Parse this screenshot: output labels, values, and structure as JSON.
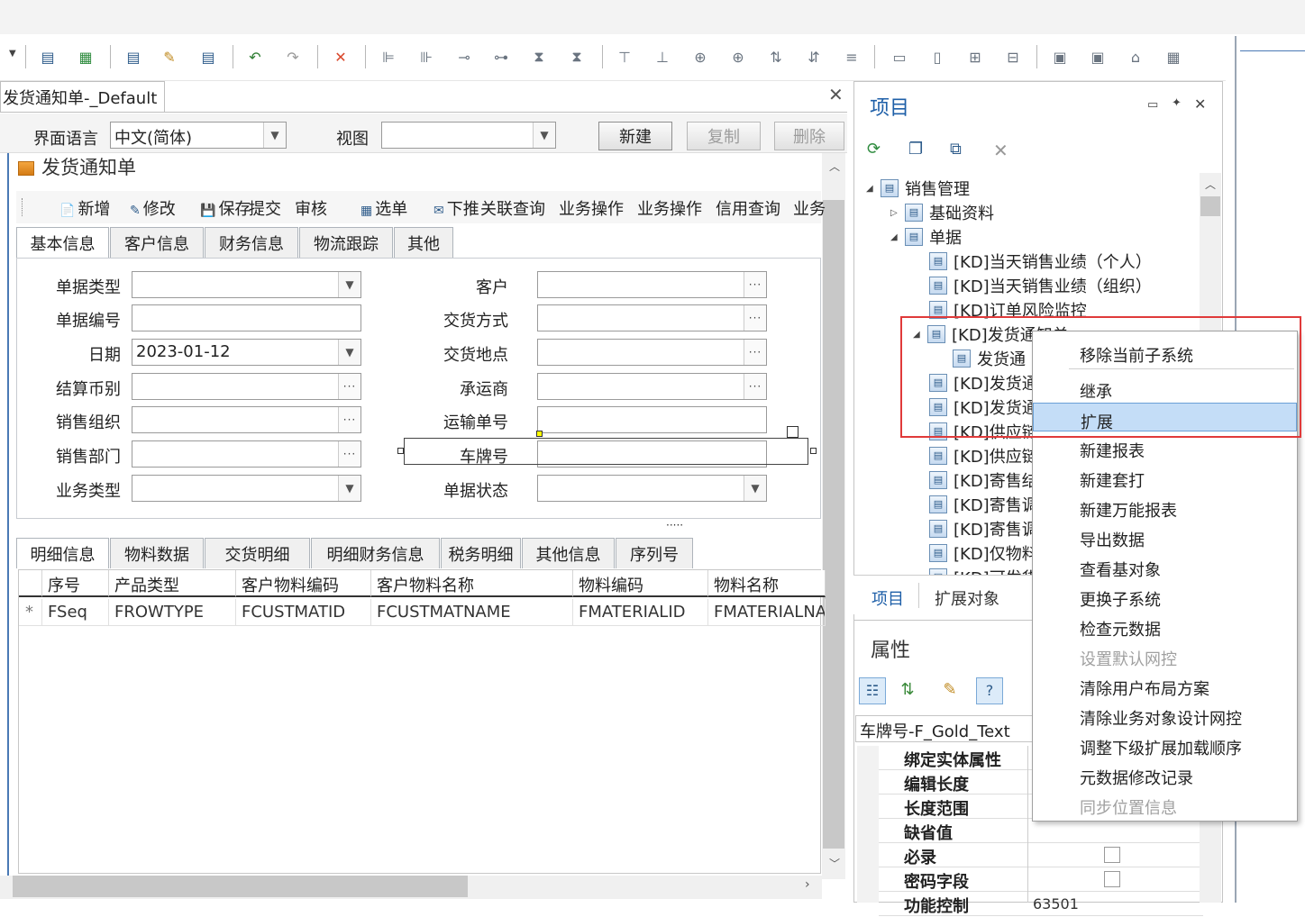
{
  "designer": {
    "doc_tab": "发货通知单-_Default",
    "lang_label": "界面语言",
    "lang_value": "中文(简体)",
    "view_label": "视图",
    "view_value": "",
    "btn_new": "新建",
    "btn_copy": "复制",
    "btn_delete": "删除",
    "form_title": "发货通知单"
  },
  "form_toolbar": {
    "items": [
      "新增",
      "修改",
      "保存",
      "提交",
      "审核",
      "选单",
      "下推",
      "关联查询",
      "业务操作",
      "业务操作",
      "信用查询",
      "业务"
    ]
  },
  "head_tabs": [
    "基本信息",
    "客户信息",
    "财务信息",
    "物流跟踪",
    "其他"
  ],
  "left_fields": [
    {
      "label": "单据类型",
      "value": "",
      "kind": "combo"
    },
    {
      "label": "单据编号",
      "value": "",
      "kind": "text"
    },
    {
      "label": "日期",
      "value": "2023-01-12",
      "kind": "combo"
    },
    {
      "label": "结算币别",
      "value": "",
      "kind": "dots"
    },
    {
      "label": "销售组织",
      "value": "",
      "kind": "dots"
    },
    {
      "label": "销售部门",
      "value": "",
      "kind": "dots"
    },
    {
      "label": "业务类型",
      "value": "",
      "kind": "combo"
    }
  ],
  "right_fields": [
    {
      "label": "客户",
      "value": "",
      "kind": "dots"
    },
    {
      "label": "交货方式",
      "value": "",
      "kind": "dots"
    },
    {
      "label": "交货地点",
      "value": "",
      "kind": "dots"
    },
    {
      "label": "承运商",
      "value": "",
      "kind": "dots"
    },
    {
      "label": "运输单号",
      "value": "",
      "kind": "text"
    },
    {
      "label": "车牌号",
      "value": "",
      "kind": "text"
    },
    {
      "label": "单据状态",
      "value": "",
      "kind": "combo"
    }
  ],
  "detail_tabs": [
    "明细信息",
    "物料数据",
    "交货明细",
    "明细财务信息",
    "税务明细",
    "其他信息",
    "序列号"
  ],
  "grid": {
    "headers": [
      "序号",
      "产品类型",
      "客户物料编码",
      "客户物料名称",
      "物料编码",
      "物料名称"
    ],
    "row_marker": "*",
    "row": [
      "FSeq",
      "FROWTYPE",
      "FCUSTMATID",
      "FCUSTMATNAME",
      "FMATERIALID",
      "FMATERIALNA"
    ]
  },
  "splitter_dots": "·····",
  "project_panel": {
    "title": "项目",
    "bottom_tabs": [
      "项目",
      "扩展对象"
    ],
    "tree": [
      {
        "label": "销售管理",
        "level": 0,
        "exp": "◢"
      },
      {
        "label": "基础资料",
        "level": 1,
        "exp": "▷"
      },
      {
        "label": "单据",
        "level": 1,
        "exp": "◢"
      },
      {
        "label": "[KD]当天销售业绩（个人）",
        "level": 2,
        "exp": ""
      },
      {
        "label": "[KD]当天销售业绩（组织）",
        "level": 2,
        "exp": ""
      },
      {
        "label": "[KD]订单风险监控",
        "level": 2,
        "exp": ""
      },
      {
        "label": "[KD]发货通知单",
        "level": 2,
        "exp": "◢"
      },
      {
        "label": "发货通",
        "level": 3,
        "exp": ""
      },
      {
        "label": "[KD]发货通",
        "level": 2,
        "exp": ""
      },
      {
        "label": "[KD]发货通",
        "level": 2,
        "exp": ""
      },
      {
        "label": "[KD]供应链",
        "level": 2,
        "exp": ""
      },
      {
        "label": "[KD]供应链",
        "level": 2,
        "exp": ""
      },
      {
        "label": "[KD]寄售结",
        "level": 2,
        "exp": ""
      },
      {
        "label": "[KD]寄售调",
        "level": 2,
        "exp": ""
      },
      {
        "label": "[KD]寄售调",
        "level": 2,
        "exp": ""
      },
      {
        "label": "[KD]仅物料",
        "level": 2,
        "exp": ""
      },
      {
        "label": "[KD]可发货",
        "level": 2,
        "exp": ""
      }
    ]
  },
  "properties_panel": {
    "title": "属性",
    "selected": "车牌号-F_Gold_Text",
    "rows": [
      {
        "name": "绑定实体属性",
        "value": ""
      },
      {
        "name": "编辑长度",
        "value": ""
      },
      {
        "name": "长度范围",
        "value": ""
      },
      {
        "name": "缺省值",
        "value": ""
      },
      {
        "name": "必录",
        "value": ""
      },
      {
        "name": "密码字段",
        "value": ""
      },
      {
        "name": "功能控制",
        "value": "63501"
      }
    ]
  },
  "context_menu": {
    "items": [
      {
        "label": "移除当前子系统",
        "state": "normal"
      },
      {
        "label": "继承",
        "state": "normal"
      },
      {
        "label": "扩展",
        "state": "selected"
      },
      {
        "label": "新建报表",
        "state": "normal"
      },
      {
        "label": "新建套打",
        "state": "normal"
      },
      {
        "label": "新建万能报表",
        "state": "normal"
      },
      {
        "label": "导出数据",
        "state": "normal"
      },
      {
        "label": "查看基对象",
        "state": "normal"
      },
      {
        "label": "更换子系统",
        "state": "normal"
      },
      {
        "label": "检查元数据",
        "state": "normal"
      },
      {
        "label": "设置默认网控",
        "state": "disabled"
      },
      {
        "label": "清除用户布局方案",
        "state": "normal"
      },
      {
        "label": "清除业务对象设计网控",
        "state": "normal"
      },
      {
        "label": "调整下级扩展加载顺序",
        "state": "normal"
      },
      {
        "label": "元数据修改记录",
        "state": "normal"
      },
      {
        "label": "同步位置信息",
        "state": "disabled"
      }
    ]
  },
  "colors": {
    "accent": "#1e5fa8",
    "highlight": "#c4ddf7",
    "red_box": "#e03a3a"
  }
}
